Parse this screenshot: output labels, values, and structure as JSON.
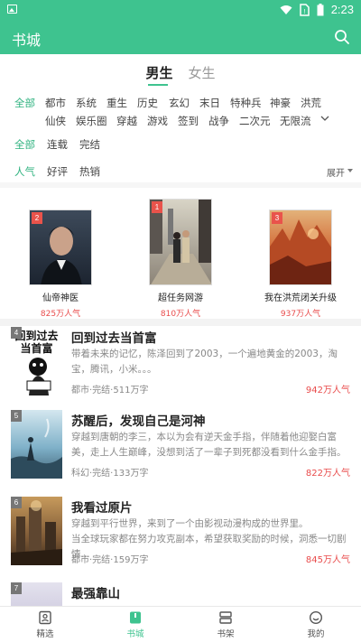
{
  "status_bar": {
    "time": "2:23"
  },
  "app_bar": {
    "title": "书城"
  },
  "gender_tabs": [
    {
      "label": "男生",
      "active": true
    },
    {
      "label": "女生",
      "active": false
    }
  ],
  "categories_row1": [
    "全部",
    "都市",
    "系统",
    "重生",
    "历史",
    "玄幻",
    "末日",
    "特种兵",
    "神豪",
    "洪荒"
  ],
  "categories_row2": [
    "仙侠",
    "娱乐圈",
    "穿越",
    "游戏",
    "签到",
    "战争",
    "二次元",
    "无限流"
  ],
  "status_filters": [
    "全部",
    "连载",
    "完结"
  ],
  "sort_filters": [
    "人气",
    "好评",
    "热销"
  ],
  "expand_label": "展开",
  "top_books": [
    {
      "rank": "2",
      "title": "仙帝神医",
      "popularity": "825万人气"
    },
    {
      "rank": "1",
      "title": "超任务网游",
      "popularity": "810万人气"
    },
    {
      "rank": "3",
      "title": "我在洪荒闭关升级",
      "popularity": "937万人气"
    }
  ],
  "books": [
    {
      "rank": "4",
      "title": "回到过去当首富",
      "cover_text": "回到过去当首富",
      "desc": "带着未来的记忆，陈泽回到了2003，一个遍地黄金的2003，淘宝，腾讯，小米。。。",
      "meta": "都市·完结·511万字",
      "popularity": "942万人气"
    },
    {
      "rank": "5",
      "title": "苏醒后，发现自己是河神",
      "desc": "穿越到唐朝的李三，本以为会有逆天金手指，伴随着他迎娶白富美，走上人生巅峰，没想到活了一辈子到死都没看到什么金手指。",
      "meta": "科幻·完结·133万字",
      "popularity": "822万人气"
    },
    {
      "rank": "6",
      "title": "我看过原片",
      "desc": "  穿越到平行世界，来到了一个由影视动漫构成的世界里。\n  当全球玩家都在努力攻克副本，希望获取奖励的时候，洞悉一切剧情...",
      "meta": "都市·完结·159万字",
      "popularity": "845万人气"
    },
    {
      "rank": "7",
      "title": "最强靠山",
      "desc": "",
      "meta": "",
      "popularity": ""
    }
  ],
  "bottom_nav": [
    {
      "label": "精选",
      "icon": "featured-icon",
      "active": false
    },
    {
      "label": "书城",
      "icon": "bookstore-icon",
      "active": true
    },
    {
      "label": "书架",
      "icon": "bookshelf-icon",
      "active": false
    },
    {
      "label": "我的",
      "icon": "profile-icon",
      "active": false
    }
  ],
  "colors": {
    "primary": "#3ec38f",
    "accent_red": "#e94c4c",
    "rank_badge": "#e9534b"
  }
}
